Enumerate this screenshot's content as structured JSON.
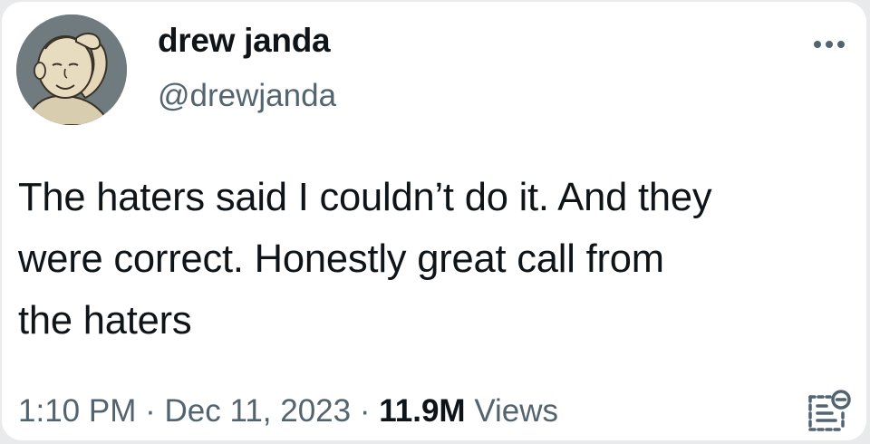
{
  "post": {
    "author": {
      "display_name": "drew janda",
      "handle": "@drewjanda",
      "avatar_icon": "cartoon-boy-scratching-head-avatar"
    },
    "more_icon": "more-horizontal-icon",
    "text_lines": [
      "The haters said I couldn’t do it. And they",
      "were correct. Honestly great call from",
      "the haters"
    ],
    "meta": {
      "time": "1:10 PM",
      "separator": "·",
      "date": "Dec 11, 2023",
      "views_count": "11.9M",
      "views_label": "Views"
    },
    "analytics_icon": "view-analytics-icon"
  },
  "colors": {
    "text_primary": "#0f1419",
    "text_secondary": "#536471",
    "card_background": "#ffffff",
    "page_background": "#e9eaec"
  }
}
